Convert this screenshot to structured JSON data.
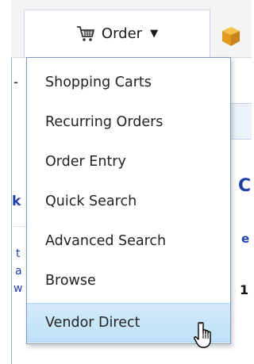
{
  "nav": {
    "order_label": "Order",
    "order_icon": "shopping-cart-icon",
    "caret_icon": "dropdown-caret-icon",
    "next_tab_icon": "package-box-icon"
  },
  "menu": {
    "items": [
      {
        "label": "Shopping Carts"
      },
      {
        "label": "Recurring Orders"
      },
      {
        "label": "Order Entry"
      },
      {
        "label": "Quick Search"
      },
      {
        "label": "Advanced Search"
      },
      {
        "label": "Browse"
      },
      {
        "label": "Vendor Direct",
        "highlighted": true
      }
    ],
    "highlight_color": "#cbe6f9",
    "border_color": "#7f9bc4"
  },
  "background_fragments": {
    "left_1": "-",
    "left_2": "k",
    "left_3": "t",
    "left_4": "a",
    "left_5": "w",
    "right_1": "C",
    "right_2": "e",
    "right_3": "1"
  },
  "cursor_icon": "hand-pointer-cursor-icon"
}
